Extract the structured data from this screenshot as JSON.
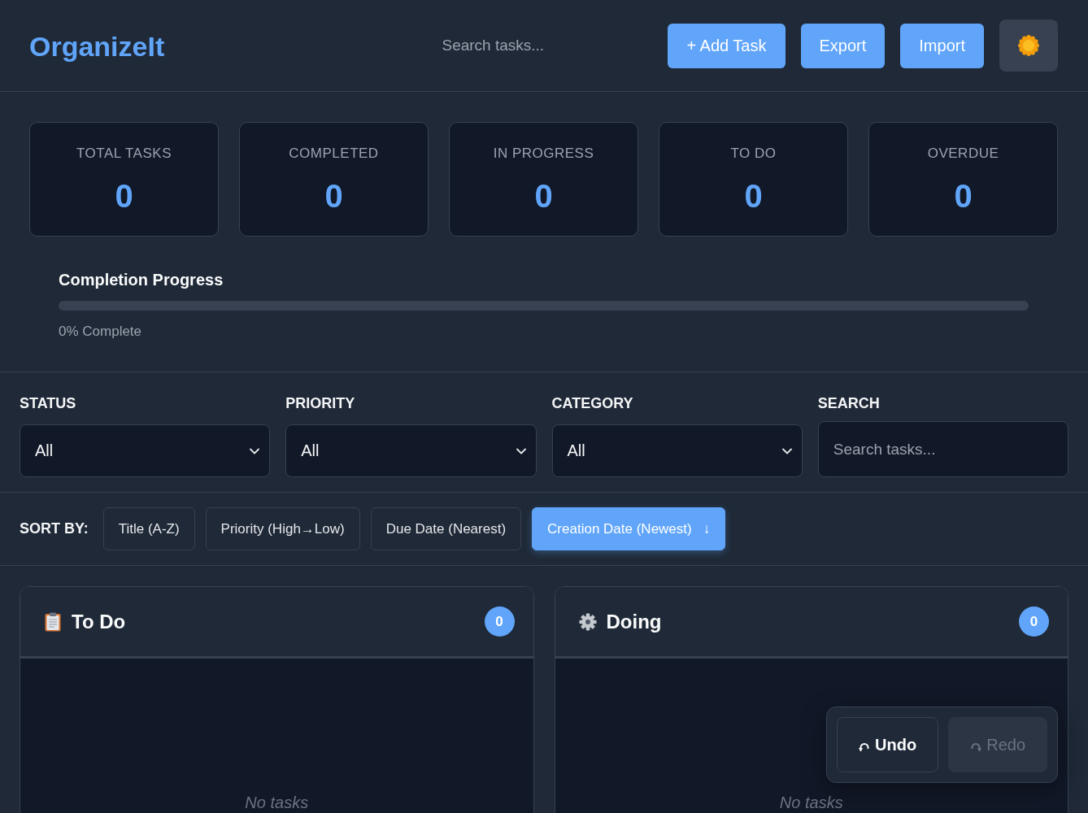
{
  "header": {
    "logo": "OrganizeIt",
    "search": {
      "placeholder": "Search tasks..."
    },
    "buttons": [
      {
        "label": "+ Add Task"
      },
      {
        "label": "Export"
      },
      {
        "label": "Import"
      }
    ]
  },
  "stats": [
    {
      "label": "TOTAL TASKS",
      "value": "0"
    },
    {
      "label": "COMPLETED",
      "value": "0"
    },
    {
      "label": "IN PROGRESS",
      "value": "0"
    },
    {
      "label": "TO DO",
      "value": "0"
    },
    {
      "label": "OVERDUE",
      "value": "0"
    }
  ],
  "progress": {
    "title": "Completion Progress",
    "level": 0,
    "caption": "0% Complete"
  },
  "filters": [
    {
      "kind": "select",
      "label": "STATUS",
      "value": "All"
    },
    {
      "kind": "select",
      "label": "PRIORITY",
      "value": "All"
    },
    {
      "kind": "select",
      "label": "CATEGORY",
      "value": "All"
    },
    {
      "kind": "search",
      "label": "SEARCH",
      "placeholder": "Search tasks..."
    }
  ],
  "sort": {
    "label": "SORT BY:",
    "options": [
      {
        "label": "Title (A-Z)",
        "selected": false
      },
      {
        "label": "Priority (High→Low)",
        "selected": false
      },
      {
        "label": "Due Date (Nearest)",
        "selected": false
      },
      {
        "label": "Creation Date (Newest)",
        "selected": true,
        "direction": "↓"
      }
    ]
  },
  "columns": [
    {
      "kind": "todo",
      "title": "To Do",
      "count": "0",
      "empty_text": "No tasks"
    },
    {
      "kind": "doing",
      "title": "Doing",
      "count": "0",
      "empty_text": "No tasks"
    }
  ],
  "history": {
    "buttons": [
      {
        "kind": "undo",
        "label": "Undo",
        "disabled": false
      },
      {
        "kind": "redo",
        "label": "Redo",
        "disabled": true
      }
    ]
  }
}
